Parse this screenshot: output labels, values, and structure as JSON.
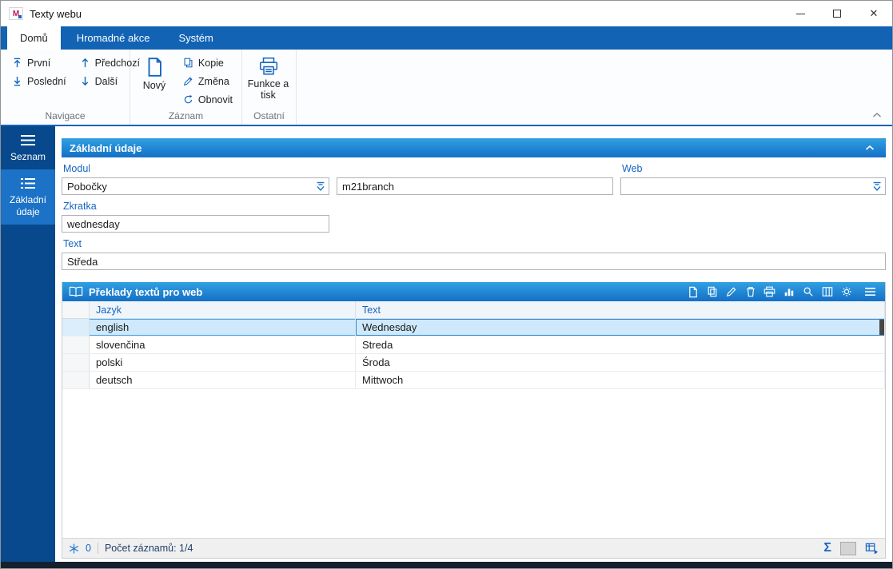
{
  "window": {
    "title": "Texty webu"
  },
  "icons": {
    "close": "✕",
    "sigma": "Σ"
  },
  "ribbon": {
    "tabs": [
      {
        "label": "Domů"
      },
      {
        "label": "Hromadné akce"
      },
      {
        "label": "Systém"
      }
    ],
    "nav": {
      "label": "Navigace",
      "first": "První",
      "last": "Poslední",
      "prev": "Předchozí",
      "next": "Další"
    },
    "record": {
      "label": "Záznam",
      "new": "Nový",
      "copy": "Kopie",
      "change": "Změna",
      "refresh": "Obnovit"
    },
    "other": {
      "label": "Ostatní",
      "functions_print": "Funkce a tisk"
    }
  },
  "sidebar": {
    "items": [
      {
        "label": "Seznam"
      },
      {
        "label": "Základní údaje"
      }
    ]
  },
  "form": {
    "title": "Základní údaje",
    "modul_label": "Modul",
    "modul_value": "Pobočky",
    "code_value": "m21branch",
    "web_label": "Web",
    "web_value": "",
    "zkratka_label": "Zkratka",
    "zkratka_value": "wednesday",
    "text_label": "Text",
    "text_value": "Středa"
  },
  "grid": {
    "title": "Překlady textů pro web",
    "columns": [
      "Jazyk",
      "Text"
    ],
    "rows": [
      {
        "jazyk": "english",
        "text": "Wednesday"
      },
      {
        "jazyk": "slovenčina",
        "text": "Streda"
      },
      {
        "jazyk": "polski",
        "text": "Środa"
      },
      {
        "jazyk": "deutsch",
        "text": "Mittwoch"
      }
    ],
    "status": {
      "flag_count": "0",
      "records_label": "Počet záznamů: 1/4"
    }
  }
}
